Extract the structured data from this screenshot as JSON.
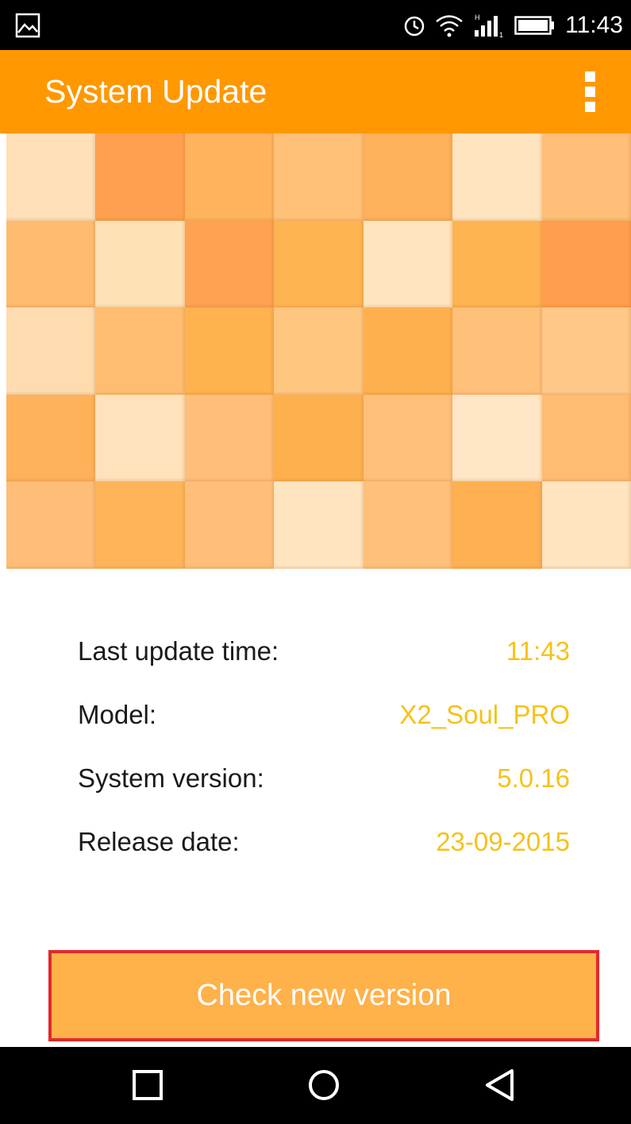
{
  "status_bar": {
    "time": "11:43",
    "icons": [
      "gallery-icon",
      "alarm-icon",
      "wifi-icon",
      "signal-icon",
      "battery-icon"
    ]
  },
  "app_bar": {
    "title": "System Update",
    "menu_icon": "overflow-menu-icon"
  },
  "hero": {
    "tile_colors": [
      "#ffe0b8",
      "#ffa050",
      "#ffb35c",
      "#ffc077",
      "#ffb05a",
      "#ffe4c0",
      "#ffbf78",
      "#ffbb6e",
      "#ffe1b6",
      "#ffa252",
      "#ffb452",
      "#ffe4c0",
      "#ffb452",
      "#ff9f4d",
      "#ffdcb0",
      "#ffbd72",
      "#ffb24e",
      "#ffc680",
      "#ffb04e",
      "#ffc07a",
      "#ffc888",
      "#ffb25a",
      "#ffe2bb",
      "#ffbe7a",
      "#ffb04e",
      "#ffc07a",
      "#ffe6c6",
      "#ffbc72",
      "#ffbe78",
      "#ffb45a",
      "#ffbf78",
      "#ffe4c0",
      "#ffc07a",
      "#ffb050",
      "#ffe4c0"
    ]
  },
  "info": {
    "rows": [
      {
        "label": "Last update time:",
        "value": "11:43"
      },
      {
        "label": "Model:",
        "value": "X2_Soul_PRO"
      },
      {
        "label": "System version:",
        "value": "5.0.16"
      },
      {
        "label": "Release date:",
        "value": "23-09-2015"
      }
    ],
    "value_color": "#f5c21a"
  },
  "check_button": {
    "label": "Check new version"
  },
  "nav_bar": {
    "icons": [
      "recents-icon",
      "home-icon",
      "back-icon"
    ]
  },
  "colors": {
    "accent": "#ff9800",
    "button": "#ffb14a",
    "highlight_border": "#e3282b"
  }
}
